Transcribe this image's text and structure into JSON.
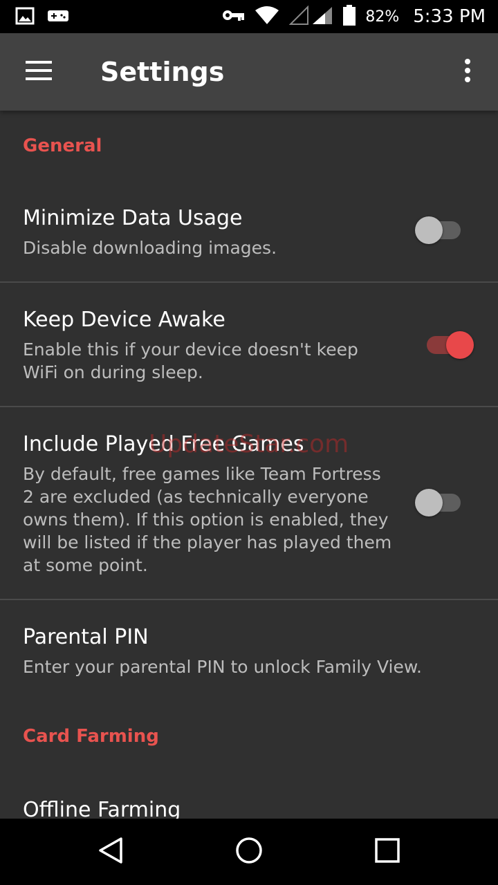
{
  "status_bar": {
    "battery_percent": "82%",
    "time": "5:33 PM",
    "icons": [
      "image-icon",
      "gamepad-icon",
      "vpn-key-icon",
      "wifi-icon",
      "signal-icon",
      "battery-icon"
    ]
  },
  "app_bar": {
    "title": "Settings",
    "icons": [
      "hamburger-menu-icon",
      "overflow-menu-icon"
    ]
  },
  "sections": {
    "general": "General",
    "card_farming": "Card Farming"
  },
  "preferences": {
    "minimize_data": {
      "title": "Minimize Data Usage",
      "summary": "Disable downloading images.",
      "enabled": false
    },
    "keep_awake": {
      "title": "Keep Device Awake",
      "summary": "Enable this if your device doesn't keep WiFi on during sleep.",
      "enabled": true
    },
    "include_free": {
      "title": "Include Played Free Games",
      "summary": "By default, free games like Team Fortress 2 are excluded (as technically everyone owns them). If this option is enabled, they will be listed if the player has played them at some point.",
      "enabled": false
    },
    "parental_pin": {
      "title": "Parental PIN",
      "summary": "Enter your parental PIN to unlock Family View."
    },
    "offline_farming": {
      "title": "Offline Farming"
    }
  },
  "watermark": "UpdateStar.com",
  "colors": {
    "accent": "#e8534f",
    "background": "#303030",
    "app_bar": "#424242"
  },
  "nav_bar": {
    "icons": [
      "back-triangle-icon",
      "home-circle-icon",
      "recents-square-icon"
    ]
  }
}
